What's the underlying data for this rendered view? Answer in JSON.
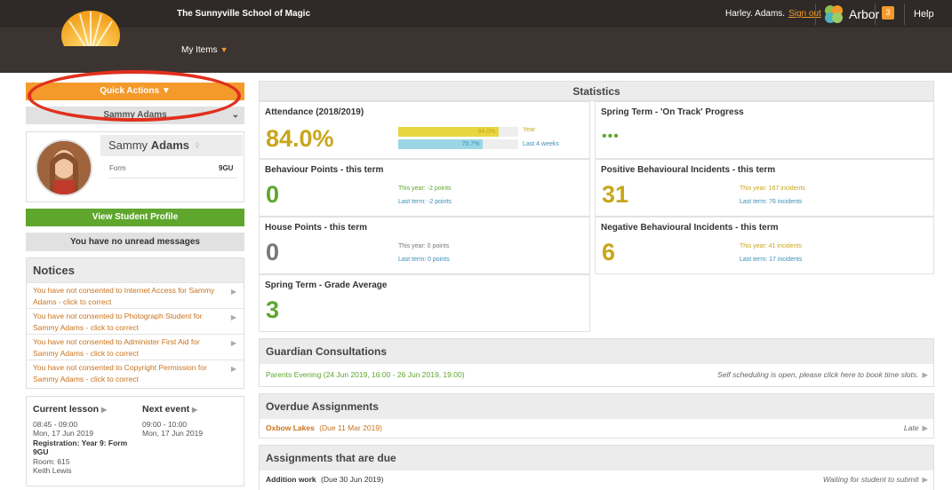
{
  "header": {
    "school_name": "The Sunnyville School of Magic",
    "my_items": "My Items",
    "user_name": "Harley. Adams.",
    "sign_out": "Sign out",
    "app_name": "Arbor",
    "notification_count": "3",
    "help": "Help"
  },
  "sidebar": {
    "quick_actions": "Quick Actions",
    "student_select": "Sammy Adams",
    "student_first": "Sammy",
    "student_last": "Adams",
    "form_label": "Form",
    "form_value": "9GU",
    "view_profile": "View Student Profile",
    "messages": "You have no unread messages",
    "notices_title": "Notices",
    "notices": [
      "You have not consented to Internet Access for Sammy Adams - click to correct",
      "You have not consented to Photograph Student for Sammy Adams - click to correct",
      "You have not consented to Administer First Aid for Sammy Adams - click to correct",
      "You have not consented to Copyright Permission for Sammy Adams - click to correct"
    ],
    "current_lesson": {
      "title": "Current lesson",
      "time": "08:45 - 09:00",
      "date": "Mon, 17 Jun 2019",
      "registration": "Registration: Year 9: Form 9GU",
      "room": "Room: 615",
      "teacher": "Keith Lewis"
    },
    "next_event": {
      "title": "Next event",
      "time": "09:00 - 10:00",
      "date": "Mon, 17 Jun 2019"
    }
  },
  "stats": {
    "title": "Statistics",
    "attendance": {
      "title": "Attendance (2018/2019)",
      "value": "84.0%",
      "year_label": "84.0%",
      "year_text": "Year",
      "year_pct": 84.0,
      "weeks_label": "70.7%",
      "weeks_text": "Last 4 weeks",
      "weeks_pct": 70.7
    },
    "on_track": {
      "title": "Spring Term - 'On Track' Progress",
      "value": "•••"
    },
    "behaviour": {
      "title": "Behaviour Points - this term",
      "value": "0",
      "this_year": "This year: -2 points",
      "last_term": "Last term: -2 points"
    },
    "positive": {
      "title": "Positive Behavioural Incidents - this term",
      "value": "31",
      "this_year": "This year: 167 incidents",
      "last_term": "Last term: 76 incidents"
    },
    "house": {
      "title": "House Points - this term",
      "value": "0",
      "this_year": "This year: 0 points",
      "last_term": "Last term: 0 points"
    },
    "negative": {
      "title": "Negative Behavioural Incidents - this term",
      "value": "6",
      "this_year": "This year: 41 incidents",
      "last_term": "Last term: 17 incidents"
    },
    "grade": {
      "title": "Spring Term - Grade Average",
      "value": "3"
    }
  },
  "guardian": {
    "title": "Guardian Consultations",
    "event": "Parents Evening (24 Jun 2019, 16:00 - 26 Jun 2019, 19:00)",
    "action": "Self scheduling is open, please click here to book time slots."
  },
  "overdue": {
    "title": "Overdue Assignments",
    "item": "Oxbow Lakes",
    "due": "(Due 11 Mar 2019)",
    "status": "Late"
  },
  "due": {
    "title": "Assignments that are due",
    "item": "Addition work",
    "due": "(Due 30 Jun 2019)",
    "status": "Waiting for student to submit"
  },
  "colors": {
    "accent": "#f39a2b",
    "green": "#5fa62d",
    "gold": "#c8a61a",
    "header_bg": "#3b3430"
  }
}
